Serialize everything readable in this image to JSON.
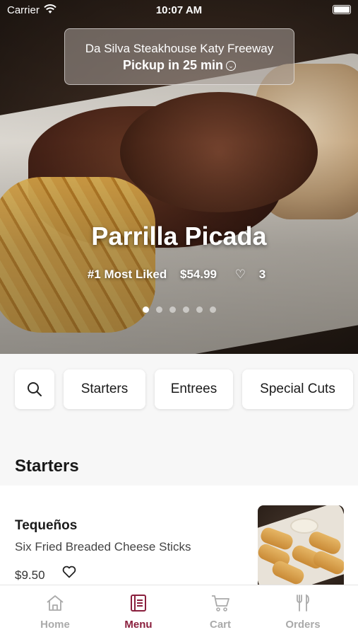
{
  "status_bar": {
    "carrier": "Carrier",
    "time": "10:07 AM"
  },
  "hero": {
    "restaurant_name": "Da Silva Steakhouse Katy Freeway",
    "pickup_text": "Pickup in 25 min",
    "featured_dish": {
      "name": "Parrilla Picada",
      "rank_label": "#1 Most Liked",
      "price": "$54.99",
      "likes": "3"
    },
    "carousel": {
      "total": 6,
      "active_index": 0
    }
  },
  "categories": {
    "search_icon": "search-icon",
    "items": [
      {
        "label": "Starters"
      },
      {
        "label": "Entrees"
      },
      {
        "label": "Special Cuts"
      }
    ]
  },
  "section": {
    "title": "Starters"
  },
  "menu_items": [
    {
      "name": "Tequeños",
      "description": "Six Fried Breaded Cheese Sticks",
      "price": "$9.50"
    }
  ],
  "tab_bar": {
    "active_color": "#8a1f3d",
    "tabs": [
      {
        "label": "Home",
        "icon": "home-icon",
        "active": false
      },
      {
        "label": "Menu",
        "icon": "menu-icon",
        "active": true
      },
      {
        "label": "Cart",
        "icon": "cart-icon",
        "active": false
      },
      {
        "label": "Orders",
        "icon": "fork-knife-icon",
        "active": false
      }
    ]
  }
}
